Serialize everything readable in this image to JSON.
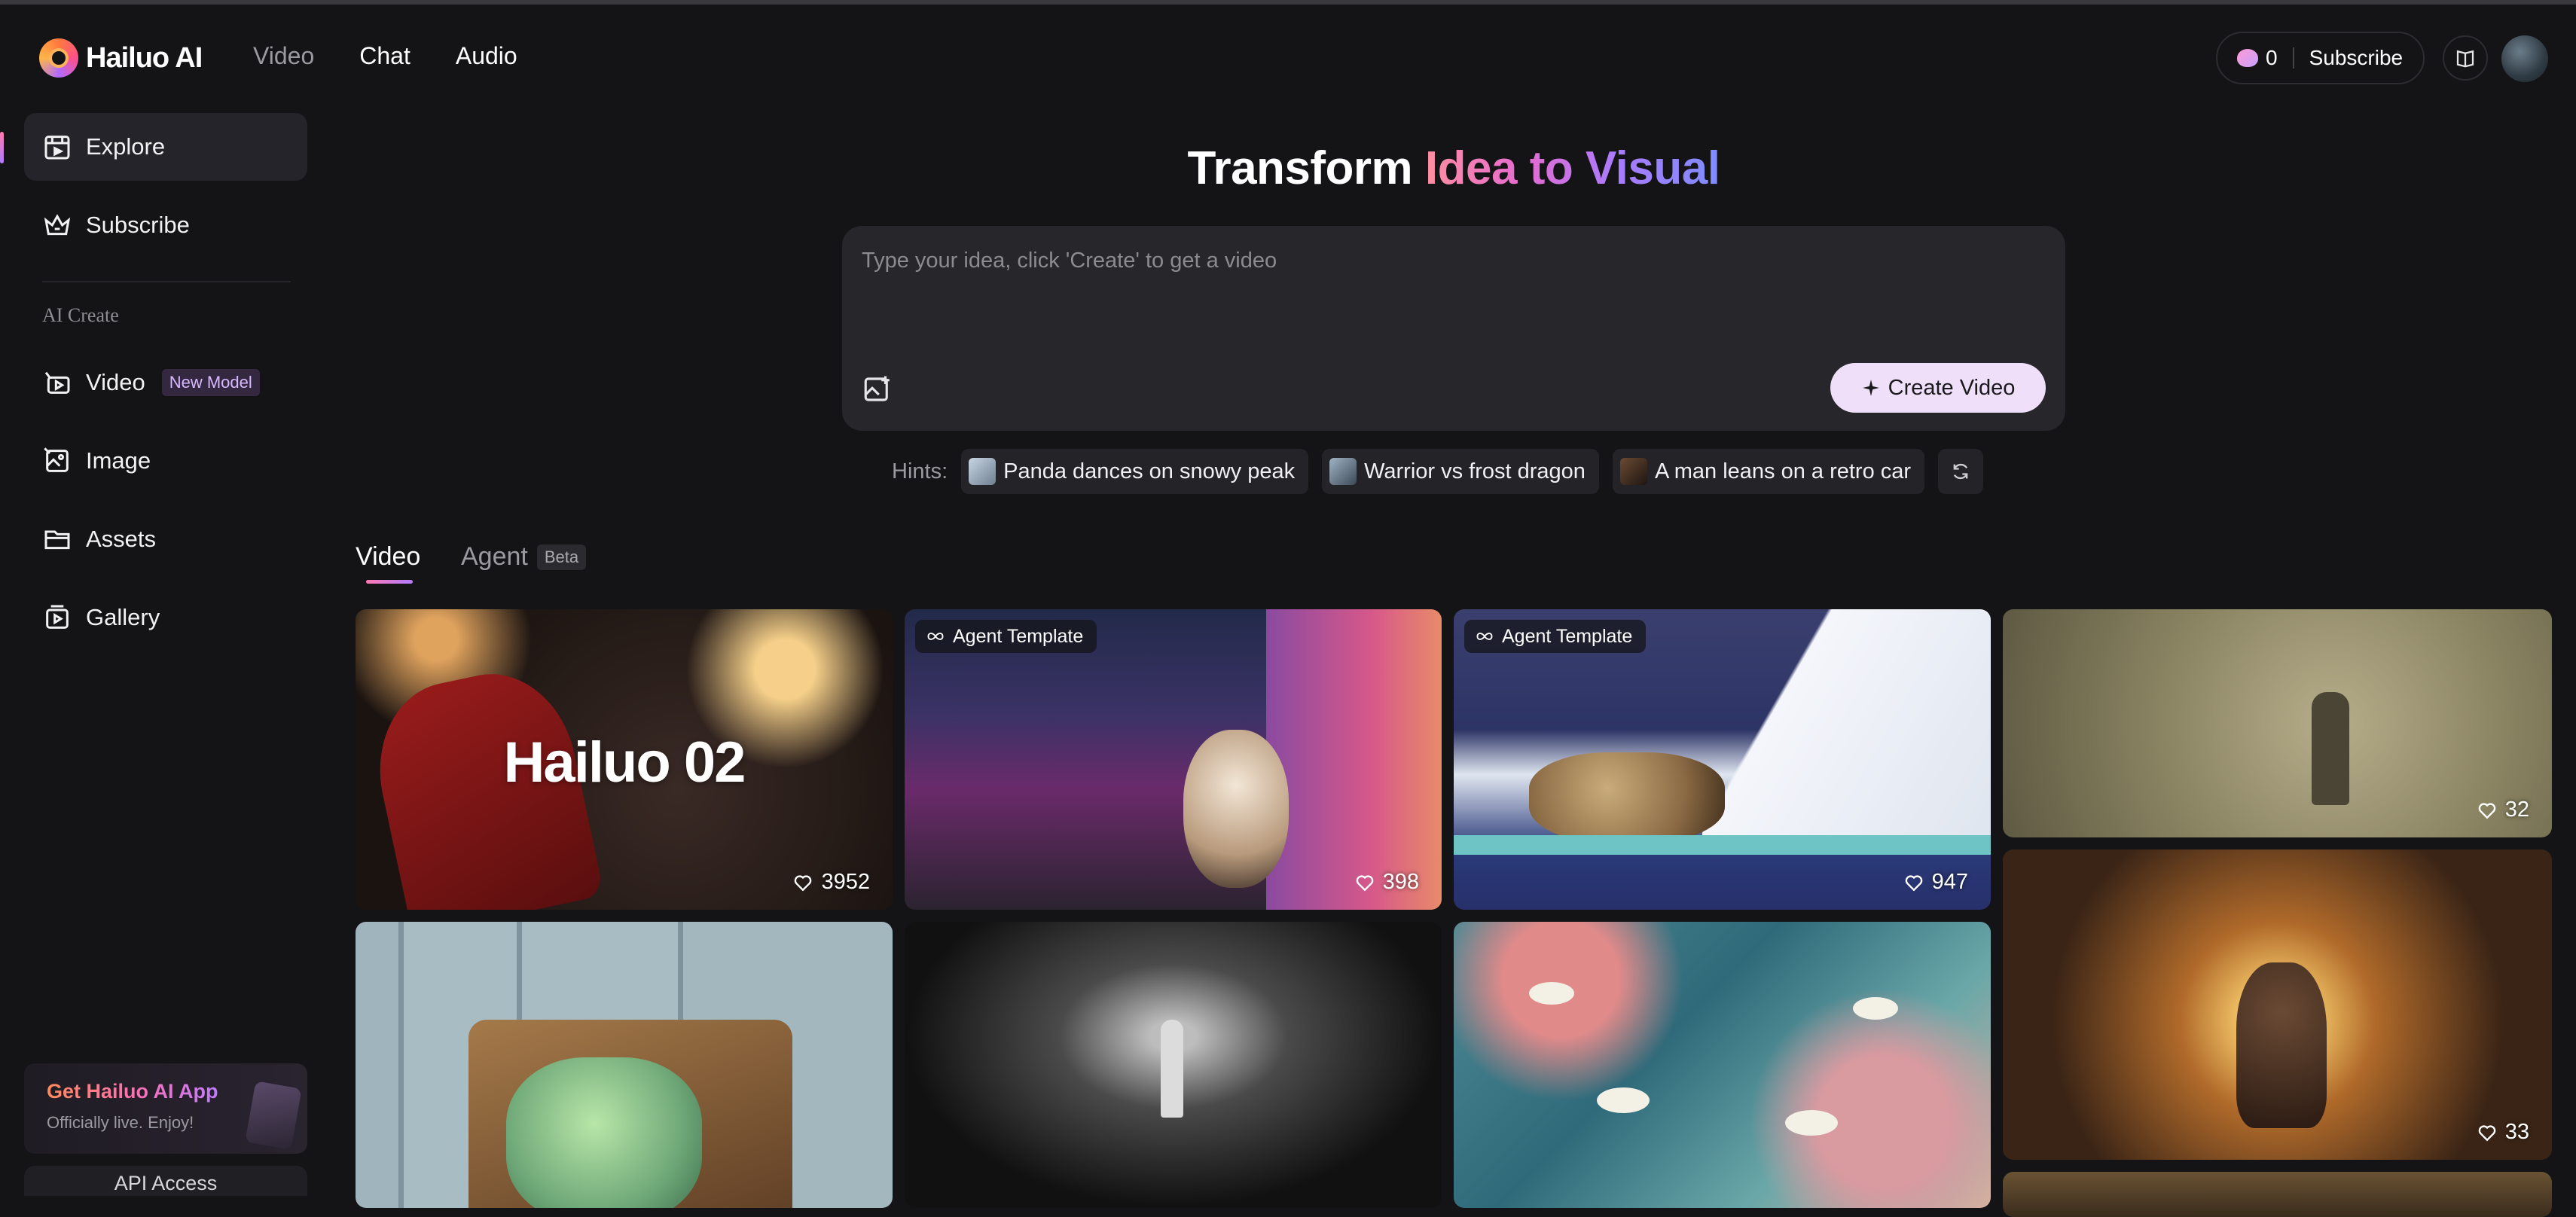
{
  "header": {
    "logo_text": "Hailuo AI",
    "nav": [
      "Video",
      "Chat",
      "Audio"
    ],
    "credits": "0",
    "subscribe_label": "Subscribe"
  },
  "sidebar": {
    "items": [
      {
        "label": "Explore",
        "icon": "explore-icon"
      },
      {
        "label": "Subscribe",
        "icon": "crown-icon"
      }
    ],
    "section_title": "AI Create",
    "create_items": [
      {
        "label": "Video",
        "icon": "video-icon",
        "badge": "New Model"
      },
      {
        "label": "Image",
        "icon": "image-icon"
      },
      {
        "label": "Assets",
        "icon": "folder-icon"
      },
      {
        "label": "Gallery",
        "icon": "gallery-icon"
      }
    ],
    "app_promo": {
      "title": "Get Hailuo AI App",
      "subtitle": "Officially live. Enjoy!"
    },
    "api_access": "API Access"
  },
  "hero": {
    "title_plain": "Transform ",
    "title_gradient": "Idea to Visual"
  },
  "prompt": {
    "placeholder": "Type your idea, click 'Create' to get a video",
    "create_label": "Create Video"
  },
  "hints": {
    "label": "Hints:",
    "items": [
      "Panda dances on snowy peak",
      "Warrior vs frost dragon",
      "A man leans on a retro car"
    ]
  },
  "tabs": {
    "video": "Video",
    "agent": "Agent",
    "agent_badge": "Beta"
  },
  "feed": {
    "agent_template_label": "Agent Template",
    "cards": [
      {
        "overlay_title": "Hailuo 02",
        "likes": "3952"
      },
      {
        "likes": "398"
      },
      {
        "likes": "947"
      },
      {
        "likes": "32"
      },
      {
        "likes": "33"
      }
    ]
  }
}
